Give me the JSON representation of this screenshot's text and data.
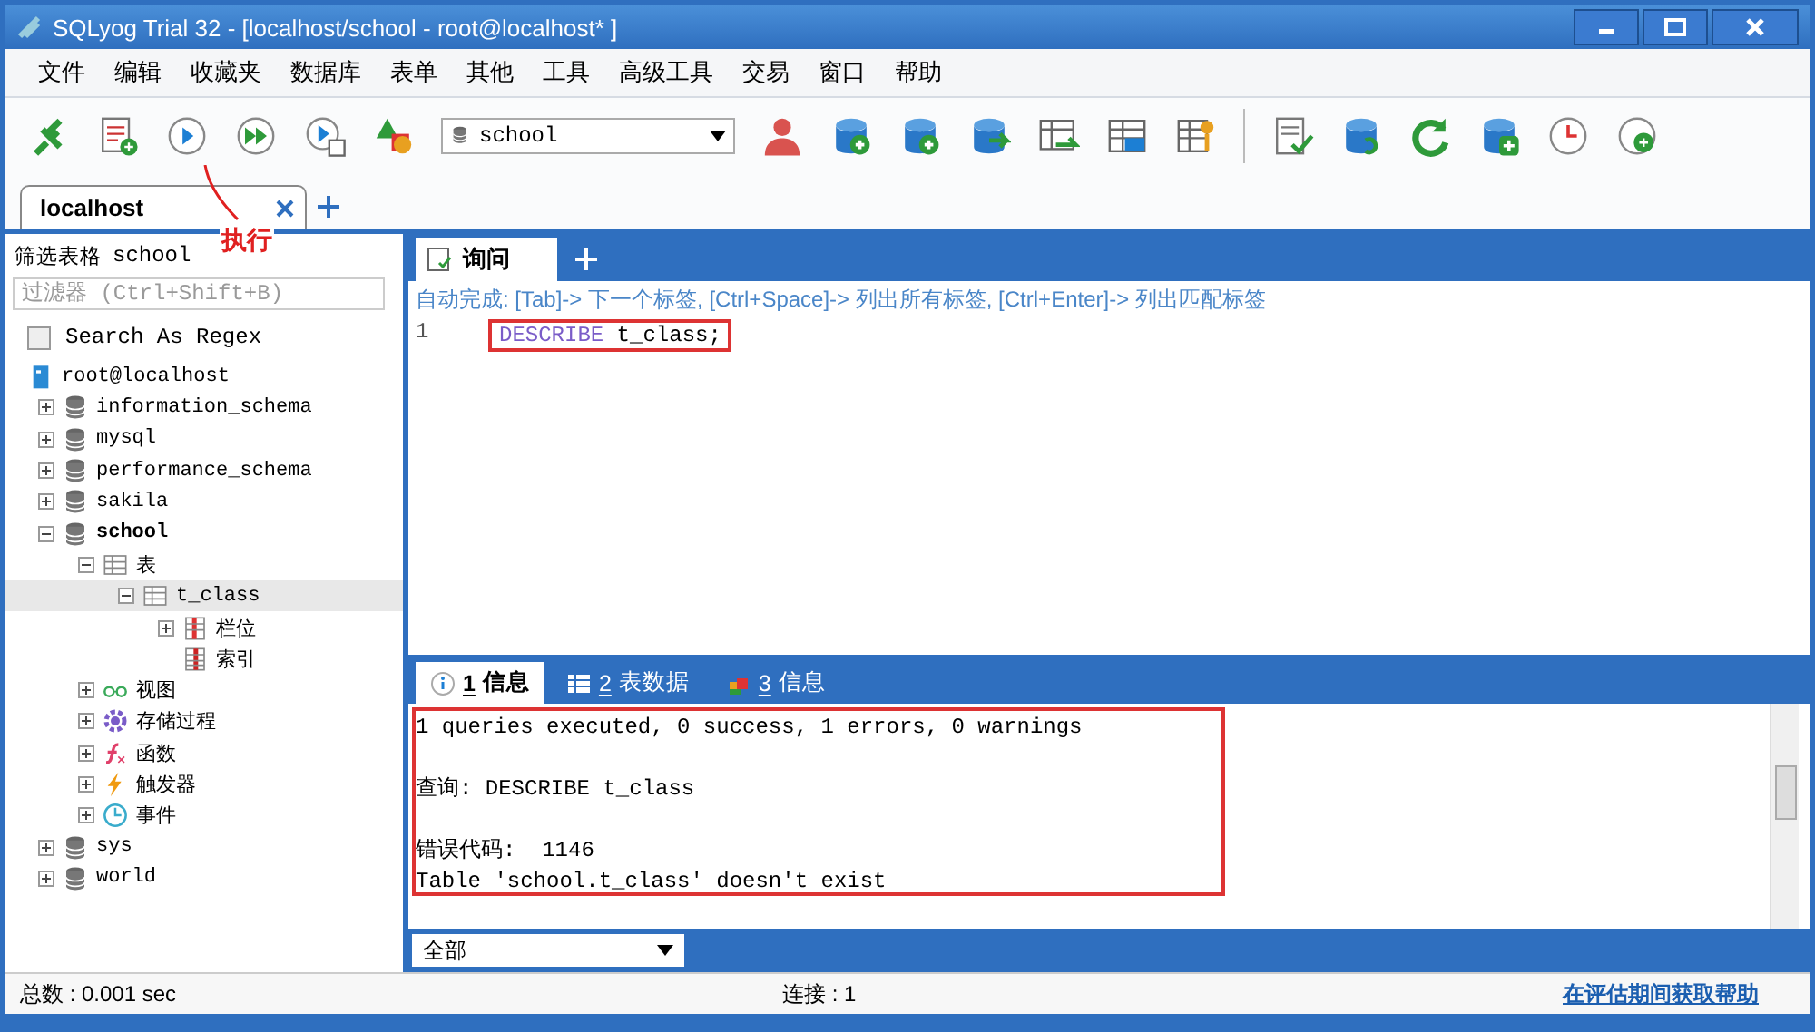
{
  "window": {
    "title": "SQLyog Trial 32 - [localhost/school - root@localhost* ]"
  },
  "menu": [
    "文件",
    "编辑",
    "收藏夹",
    "数据库",
    "表单",
    "其他",
    "工具",
    "高级工具",
    "交易",
    "窗口",
    "帮助"
  ],
  "toolbar": {
    "database_select": "school"
  },
  "connection_tabs": [
    {
      "label": "localhost",
      "selected": true
    }
  ],
  "annotation": {
    "label": "执行"
  },
  "object_browser": {
    "title": "筛选表格",
    "database": "school",
    "filter_placeholder": "过滤器 (Ctrl+Shift+B)",
    "regex": {
      "label": "Search As Regex",
      "checked": false
    },
    "tree": [
      {
        "label": "root@localhost",
        "kind": "server",
        "selected": false,
        "children": [
          {
            "label": "information_schema",
            "kind": "database",
            "expanded": false,
            "active": false,
            "selected": false
          },
          {
            "label": "mysql",
            "kind": "database",
            "expanded": false,
            "active": false,
            "selected": false
          },
          {
            "label": "performance_schema",
            "kind": "database",
            "expanded": false,
            "active": false,
            "selected": false
          },
          {
            "label": "sakila",
            "kind": "database",
            "expanded": false,
            "active": false,
            "selected": false
          },
          {
            "label": "school",
            "kind": "database",
            "expanded": true,
            "active": true,
            "selected": false,
            "children": [
              {
                "label": "表",
                "kind": "tables",
                "expanded": true,
                "selected": false,
                "children": [
                  {
                    "label": "t_class",
                    "kind": "table",
                    "expanded": true,
                    "selected": true,
                    "children": [
                      {
                        "label": "栏位",
                        "kind": "columns",
                        "expanded": false,
                        "selected": false
                      },
                      {
                        "label": "索引",
                        "kind": "indexes",
                        "selected": false
                      }
                    ]
                  }
                ]
              },
              {
                "label": "视图",
                "kind": "views",
                "expanded": false,
                "selected": false
              },
              {
                "label": "存储过程",
                "kind": "procedures",
                "expanded": false,
                "selected": false
              },
              {
                "label": "函数",
                "kind": "functions",
                "expanded": false,
                "selected": false
              },
              {
                "label": "触发器",
                "kind": "triggers",
                "expanded": false,
                "selected": false
              },
              {
                "label": "事件",
                "kind": "events",
                "expanded": false,
                "selected": false
              }
            ]
          },
          {
            "label": "sys",
            "kind": "database",
            "expanded": false,
            "active": false,
            "selected": false
          },
          {
            "label": "world",
            "kind": "database",
            "expanded": false,
            "active": false,
            "selected": false
          }
        ]
      }
    ]
  },
  "query_tabs": [
    {
      "label": "询问",
      "selected": true
    }
  ],
  "editor": {
    "hint": "自动完成: [Tab]-> 下一个标签, [Ctrl+Space]-> 列出所有标签, [Ctrl+Enter]-> 列出匹配标签",
    "lines": [
      {
        "number": "1",
        "keyword": "DESCRIBE",
        "rest": " t_class;"
      }
    ]
  },
  "result_tabs": [
    {
      "number": "1",
      "label": "信息",
      "kind": "info",
      "selected": true
    },
    {
      "number": "2",
      "label": "表数据",
      "kind": "grid",
      "selected": false
    },
    {
      "number": "3",
      "label": "信息",
      "kind": "info-color",
      "selected": false
    }
  ],
  "messages": [
    {
      "lines": [
        "1 queries executed, 0 success, 1 errors, 0 warnings"
      ]
    },
    {
      "lines": [
        "查询: DESCRIBE t_class"
      ]
    },
    {
      "lines": [
        "错误代码:  1146",
        "Table 'school.t_class' doesn't exist"
      ]
    }
  ],
  "result_filter": "全部",
  "status_bar": {
    "total": "总数 : 0.001 sec",
    "connections": "连接 : 1",
    "help_link": "在评估期间获取帮助"
  }
}
